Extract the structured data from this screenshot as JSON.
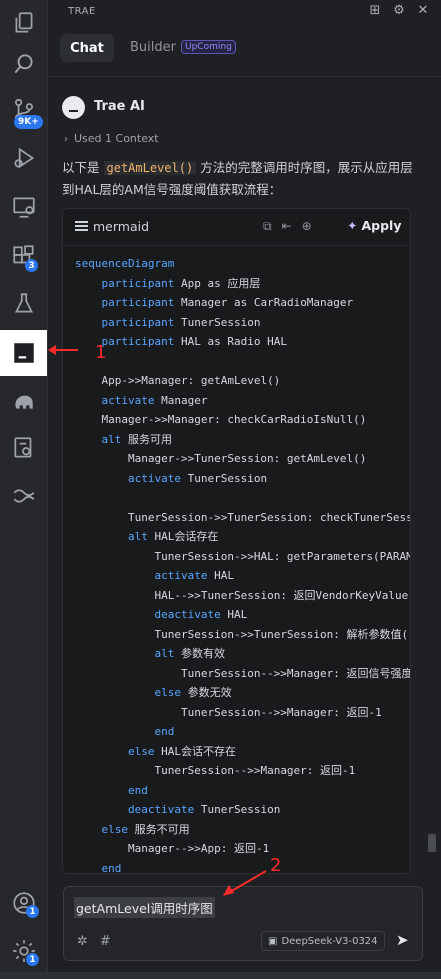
{
  "app": {
    "panel_title": "TRAE"
  },
  "activity_bar": {
    "items": [
      {
        "name": "explorer-icon"
      },
      {
        "name": "search-icon"
      },
      {
        "name": "source-control-icon",
        "badge": "9K+"
      },
      {
        "name": "run-debug-icon"
      },
      {
        "name": "remote-explorer-icon"
      },
      {
        "name": "extensions-icon",
        "badge": "3"
      },
      {
        "name": "testing-icon"
      },
      {
        "name": "trae-ai-icon",
        "active": true
      },
      {
        "name": "elephant-icon"
      },
      {
        "name": "settings-sync-icon"
      },
      {
        "name": "waves-icon"
      }
    ],
    "bottom": [
      {
        "name": "account-icon",
        "badge": "1"
      },
      {
        "name": "manage-gear-icon",
        "badge": "1"
      }
    ]
  },
  "tabs": {
    "chat": "Chat",
    "builder": "Builder",
    "builder_badge": "UpComing"
  },
  "message": {
    "author": "Trae AI",
    "context": "Used 1 Context",
    "desc_prefix": "以下是",
    "desc_code": "getAmLevel()",
    "desc_suffix": "方法的完整调用时序图，展示从应用层到HAL层的AM信号强度阈值获取流程："
  },
  "code_block": {
    "language": "mermaid",
    "apply_label": "Apply",
    "lines": [
      {
        "indent": 0,
        "kw": "sequenceDiagram",
        "rest": ""
      },
      {
        "indent": 4,
        "kw": "participant",
        "rest": " App as 应用层"
      },
      {
        "indent": 4,
        "kw": "participant",
        "rest": " Manager as CarRadioManager"
      },
      {
        "indent": 4,
        "kw": "participant",
        "rest": " TunerSession"
      },
      {
        "indent": 4,
        "kw": "participant",
        "rest": " HAL as Radio HAL"
      },
      {
        "indent": 0,
        "kw": "",
        "rest": ""
      },
      {
        "indent": 4,
        "kw": "",
        "rest": "App->>Manager: getAmLevel()"
      },
      {
        "indent": 4,
        "kw": "activate",
        "rest": " Manager"
      },
      {
        "indent": 4,
        "kw": "",
        "rest": "Manager->>Manager: checkCarRadioIsNull()"
      },
      {
        "indent": 4,
        "kw": "alt",
        "rest": " 服务可用"
      },
      {
        "indent": 8,
        "kw": "",
        "rest": "Manager->>TunerSession: getAmLevel()"
      },
      {
        "indent": 8,
        "kw": "activate",
        "rest": " TunerSession"
      },
      {
        "indent": 0,
        "kw": "",
        "rest": ""
      },
      {
        "indent": 8,
        "kw": "",
        "rest": "TunerSession->>TunerSession: checkTunerSession"
      },
      {
        "indent": 8,
        "kw": "alt",
        "rest": " HAL会话存在"
      },
      {
        "indent": 12,
        "kw": "",
        "rest": "TunerSession->>HAL: getParameters(PARAM"
      },
      {
        "indent": 12,
        "kw": "activate",
        "rest": " HAL"
      },
      {
        "indent": 12,
        "kw": "",
        "rest": "HAL-->>TunerSession: 返回VendorKeyValue"
      },
      {
        "indent": 12,
        "kw": "deactivate",
        "rest": " HAL"
      },
      {
        "indent": 12,
        "kw": "",
        "rest": "TunerSession->>TunerSession: 解析参数值("
      },
      {
        "indent": 12,
        "kw": "alt",
        "rest": " 参数有效"
      },
      {
        "indent": 16,
        "kw": "",
        "rest": "TunerSession-->>Manager: 返回信号强度"
      },
      {
        "indent": 12,
        "kw": "else",
        "rest": " 参数无效"
      },
      {
        "indent": 16,
        "kw": "",
        "rest": "TunerSession-->>Manager: 返回-1"
      },
      {
        "indent": 12,
        "kw": "end",
        "rest": ""
      },
      {
        "indent": 8,
        "kw": "else",
        "rest": " HAL会话不存在"
      },
      {
        "indent": 12,
        "kw": "",
        "rest": "TunerSession-->>Manager: 返回-1"
      },
      {
        "indent": 8,
        "kw": "end",
        "rest": ""
      },
      {
        "indent": 8,
        "kw": "deactivate",
        "rest": " TunerSession"
      },
      {
        "indent": 4,
        "kw": "else",
        "rest": " 服务不可用"
      },
      {
        "indent": 8,
        "kw": "",
        "rest": "Manager-->>App: 返回-1"
      },
      {
        "indent": 4,
        "kw": "end",
        "rest": ""
      }
    ]
  },
  "composer": {
    "query": "getAmLevel调用时序图",
    "model": "DeepSeek-V3-0324"
  },
  "annotations": {
    "one": "1",
    "two": "2"
  },
  "colors": {
    "accent": "#2b77f1",
    "keyword": "#5aa5ff",
    "annotation": "#ff2b2b"
  }
}
